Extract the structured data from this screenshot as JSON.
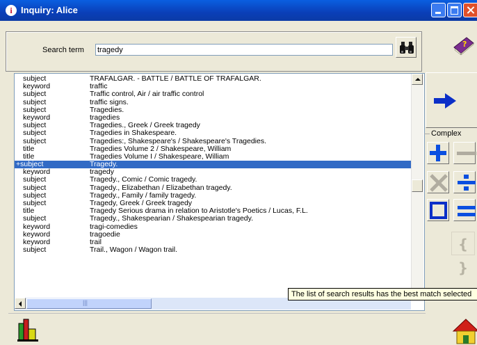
{
  "window": {
    "title": "Inquiry: Alice",
    "controls": [
      "minimize",
      "maximize",
      "close"
    ]
  },
  "search": {
    "label": "Search term",
    "value": "tragedy",
    "button_icon": "binoculars-icon"
  },
  "results": {
    "rows": [
      {
        "type": "subject",
        "value": "TRAFALGAR. - BATTLE / BATTLE OF TRAFALGAR."
      },
      {
        "type": "keyword",
        "value": "traffic"
      },
      {
        "type": "subject",
        "value": "Traffic control, Air / air traffic control"
      },
      {
        "type": "subject",
        "value": "traffic signs."
      },
      {
        "type": "subject",
        "value": "Tragedies."
      },
      {
        "type": "keyword",
        "value": "tragedies"
      },
      {
        "type": "subject",
        "value": "Tragedies., Greek / Greek tragedy"
      },
      {
        "type": "subject",
        "value": "Tragedies in Shakespeare."
      },
      {
        "type": "subject",
        "value": "Tragedies:, Shakespeare's / Shakespeare's Tragedies."
      },
      {
        "type": "title",
        "value": "Tragedies Volume 2 / Shakespeare, William"
      },
      {
        "type": "title",
        "value": "Tragedies Volume I / Shakespeare, William"
      },
      {
        "type": "+subject",
        "value": "Tragedy.",
        "selected": true
      },
      {
        "type": "keyword",
        "value": "tragedy"
      },
      {
        "type": "subject",
        "value": "Tragedy., Comic / Comic tragedy."
      },
      {
        "type": "subject",
        "value": "Tragedy., Elizabethan / Elizabethan tragedy."
      },
      {
        "type": "subject",
        "value": "Tragedy., Family / family tragedy."
      },
      {
        "type": "subject",
        "value": "Tragedy, Greek / Greek tragedy"
      },
      {
        "type": "title",
        "value": "Tragedy Serious drama in relation to Aristotle's Poetics / Lucas, F.L."
      },
      {
        "type": "subject",
        "value": "Tragedy., Shakespearian / Shakespearian tragedy."
      },
      {
        "type": "keyword",
        "value": "tragi-comedies"
      },
      {
        "type": "keyword",
        "value": "tragoedie"
      },
      {
        "type": "keyword",
        "value": "trail"
      },
      {
        "type": "subject",
        "value": "Trail., Wagon / Wagon trail."
      }
    ]
  },
  "tooltip": "The list of search results has the best match selected",
  "side": {
    "complex_label": "Complex",
    "go_icon": "right-arrow-icon",
    "operators": [
      "plus-icon",
      "minus-icon",
      "multiply-icon",
      "divide-icon",
      "square-icon",
      "equals-icon"
    ],
    "braces": "{ }"
  },
  "colors": {
    "titlebar": "#0A5FE0",
    "selection": "#316AC5",
    "operator_blue": "#0B4FE0",
    "disabled_gray": "#b0aca0"
  }
}
